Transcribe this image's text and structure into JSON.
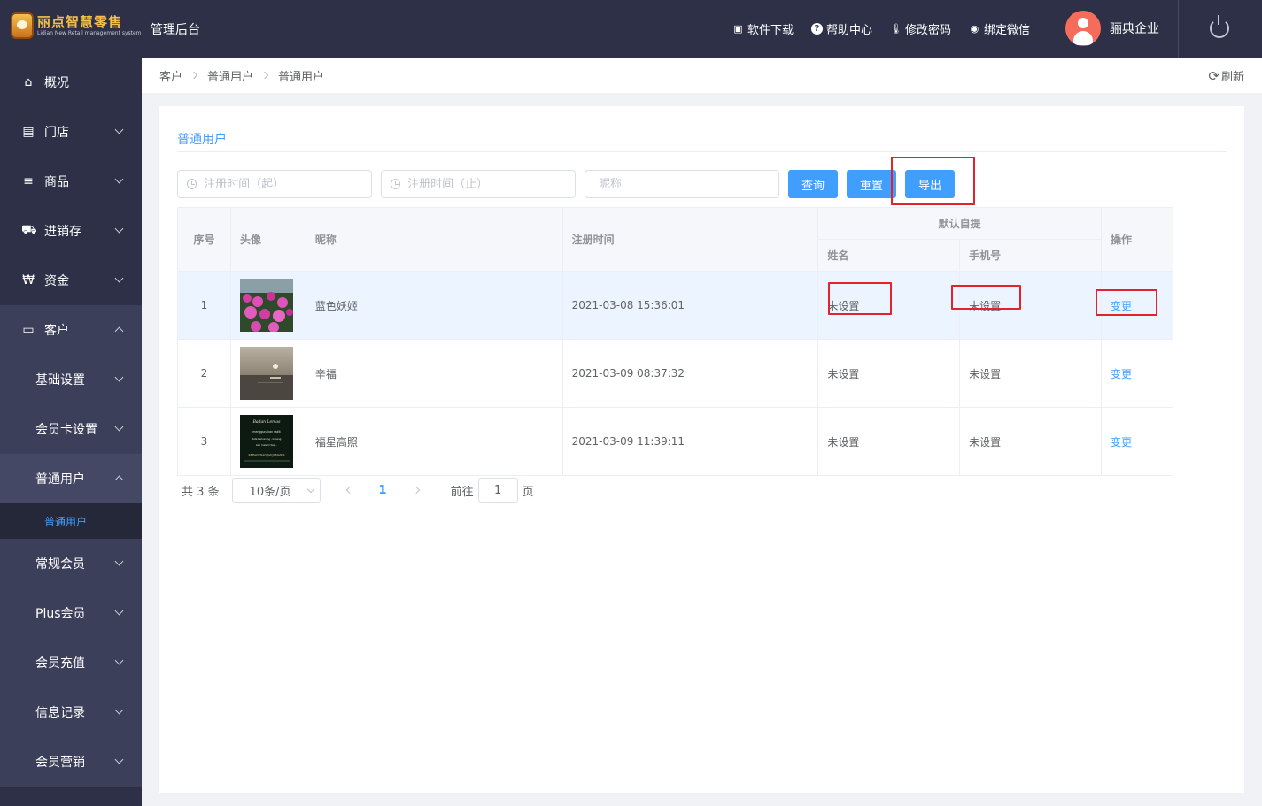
{
  "header": {
    "logo_title": "丽点智慧零售",
    "logo_subtitle": "Lidian New Retail management system",
    "app_title": "管理后台",
    "nav": [
      {
        "label": "软件下载",
        "icon": "app-download-icon"
      },
      {
        "label": "帮助中心",
        "icon": "help-icon"
      },
      {
        "label": "修改密码",
        "icon": "thermometer-icon"
      },
      {
        "label": "绑定微信",
        "icon": "wechat-icon"
      }
    ],
    "user_name": "骊典企业"
  },
  "sidebar": {
    "items": [
      {
        "label": "概况",
        "icon": "home-icon"
      },
      {
        "label": "门店",
        "icon": "building-icon"
      },
      {
        "label": "商品",
        "icon": "list-icon"
      },
      {
        "label": "进销存",
        "icon": "truck-icon"
      },
      {
        "label": "资金",
        "icon": "won-icon"
      },
      {
        "label": "客户",
        "icon": "id-card-icon"
      }
    ],
    "customer_sub": [
      {
        "label": "基础设置"
      },
      {
        "label": "会员卡设置"
      },
      {
        "label": "普通用户"
      },
      {
        "label": "常规会员"
      },
      {
        "label": "Plus会员"
      },
      {
        "label": "会员充值"
      },
      {
        "label": "信息记录"
      },
      {
        "label": "会员营销"
      }
    ],
    "active_leaf": "普通用户"
  },
  "breadcrumb": [
    "客户",
    "普通用户",
    "普通用户"
  ],
  "refresh_label": "刷新",
  "panel": {
    "title": "普通用户",
    "filters": {
      "reg_start_placeholder": "注册时间（起）",
      "reg_end_placeholder": "注册时间（止）",
      "nickname_placeholder": "昵称"
    },
    "buttons": {
      "query": "查询",
      "reset": "重置",
      "export": "导出"
    }
  },
  "table": {
    "headers": {
      "index": "序号",
      "avatar": "头像",
      "nickname": "昵称",
      "reg_time": "注册时间",
      "default_pickup": "默认自提",
      "name": "姓名",
      "phone": "手机号",
      "action": "操作"
    },
    "rows": [
      {
        "index": "1",
        "avatar": "flower-photo",
        "nickname": "蓝色妖姬",
        "reg_time": "2021-03-08 15:36:01",
        "name": "未设置",
        "phone": "未设置",
        "action": "变更"
      },
      {
        "index": "2",
        "avatar": "sea-sunset-photo",
        "nickname": "辛福",
        "reg_time": "2021-03-09 08:37:32",
        "name": "未设置",
        "phone": "未设置",
        "action": "变更"
      },
      {
        "index": "3",
        "avatar": "text-card-photo",
        "nickname": "福星高照",
        "reg_time": "2021-03-09 11:39:11",
        "name": "未设置",
        "phone": "未设置",
        "action": "变更"
      }
    ],
    "avatar3_text": [
      "Badan Lemas",
      "menggunakan sakit",
      "Mata berkunang - kunang,",
      "kaki melemi tiap...",
      "KERACUNAN JANJI MANIS"
    ]
  },
  "pagination": {
    "total": "共 3 条",
    "page_size": "10条/页",
    "current": "1",
    "goto_label": "前往",
    "goto_value": "1",
    "page_suffix": "页"
  }
}
